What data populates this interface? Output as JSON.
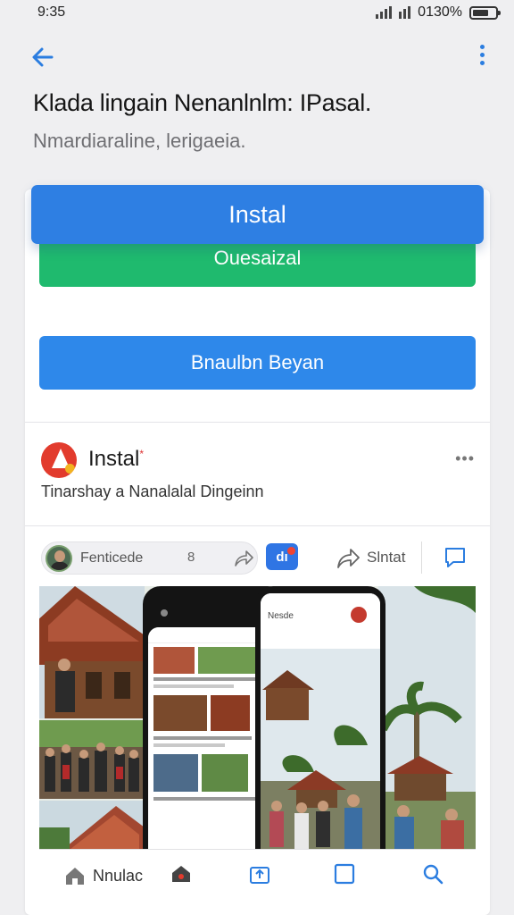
{
  "status_bar": {
    "time": "9:35",
    "battery_text": "0130%"
  },
  "header": {
    "back_icon": "arrow-left-icon",
    "more_icon": "more-vert-icon",
    "title": "Klada lingain Nenanlnlm: IPasal.",
    "subtitle": "Nmardiaraline, lerigaeia."
  },
  "buttons": {
    "install_label": "Instal",
    "green_label": "Ouesaizal",
    "blue_label": "Bnaulbn Beyan"
  },
  "app": {
    "name": "Instal",
    "badge": "*",
    "description": "Tinarshay a Nanalalal Dingeinn",
    "menu": "•••"
  },
  "actions": {
    "chip_text": "Fenticede",
    "chip_pin": "8",
    "fb_label": "dı",
    "share_label": "Slntat",
    "icons": [
      "share-icon",
      "comment-icon"
    ]
  },
  "phone_right": {
    "label": "Nesde"
  },
  "bottom_nav": {
    "home_label": "Nnulac",
    "icons": [
      "home-icon",
      "camera-icon",
      "box-arrow-icon",
      "square-icon",
      "search-icon"
    ]
  },
  "colors": {
    "accent_blue": "#2e7fe3",
    "green": "#1fba6e",
    "brand_red": "#e23b2d"
  }
}
